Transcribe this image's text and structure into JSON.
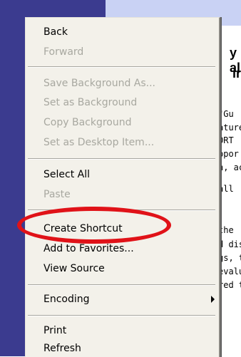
{
  "background": {
    "heading_fragments": [
      "y al",
      "ir"
    ],
    "snippets": [
      "\"Gu",
      "ature",
      "ORT",
      "ppor",
      "n, ac",
      "all",
      "the",
      "d dis",
      "gs, t",
      "evalu",
      "red t"
    ]
  },
  "context_menu": {
    "items": [
      {
        "label": "Back",
        "enabled": true
      },
      {
        "label": "Forward",
        "enabled": false
      },
      {
        "label": "Save Background As...",
        "enabled": false
      },
      {
        "label": "Set as Background",
        "enabled": false
      },
      {
        "label": "Copy Background",
        "enabled": false
      },
      {
        "label": "Set as Desktop Item...",
        "enabled": false
      },
      {
        "label": "Select All",
        "enabled": true
      },
      {
        "label": "Paste",
        "enabled": false
      },
      {
        "label": "Create Shortcut",
        "enabled": true,
        "highlighted": true
      },
      {
        "label": "Add to Favorites...",
        "enabled": true
      },
      {
        "label": "View Source",
        "enabled": true
      },
      {
        "label": "Encoding",
        "enabled": true,
        "submenu": true
      },
      {
        "label": "Print",
        "enabled": true
      },
      {
        "label": "Refresh",
        "enabled": true
      }
    ]
  },
  "colors": {
    "annotation_ring": "#e01218",
    "menu_background": "#f3f1ea",
    "disabled_text": "#a8a8a0"
  }
}
